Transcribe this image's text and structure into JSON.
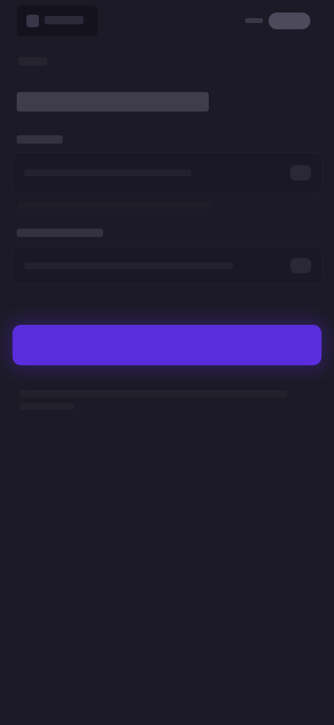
{
  "header": {
    "logo_icon": "app-logo-icon"
  },
  "colors": {
    "background": "#1c1a26",
    "primary_button": "#5a2ddc"
  },
  "form": {
    "fields": [
      {
        "icon": "field-action-icon"
      },
      {
        "icon": "field-action-icon"
      }
    ]
  }
}
